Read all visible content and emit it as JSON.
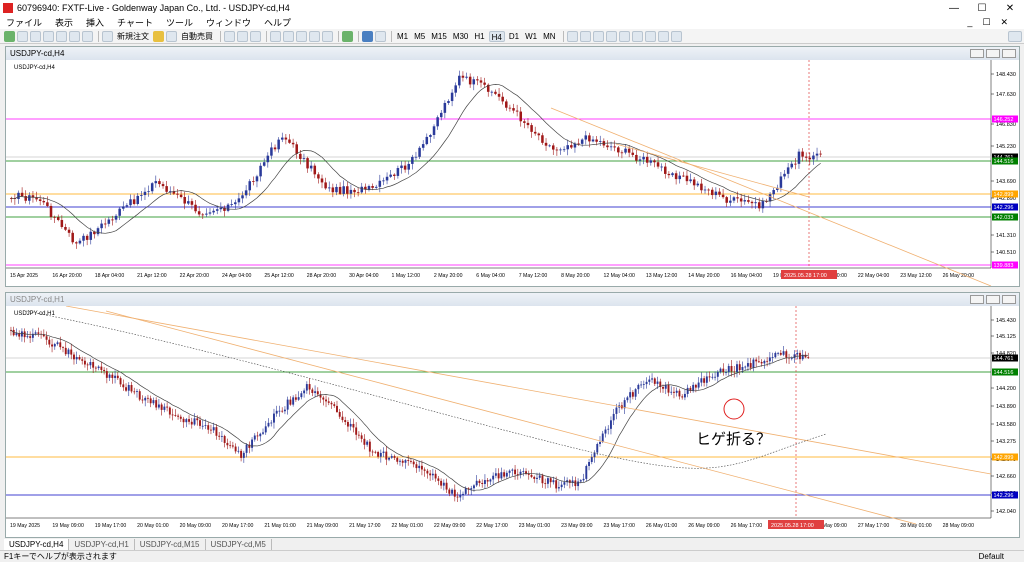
{
  "window": {
    "title": "60796940: FXTF-Live - Goldenway Japan Co., Ltd. - USDJPY-cd,H4",
    "minimize": "—",
    "maximize": "☐",
    "close": "✕"
  },
  "menu": [
    "ファイル",
    "表示",
    "挿入",
    "チャート",
    "ツール",
    "ウィンドウ",
    "ヘルプ"
  ],
  "menu_right": [
    "_",
    "☐",
    "✕"
  ],
  "toolbar": {
    "new_order": "新規注文",
    "auto_trade": "自動売買",
    "timeframes": [
      "M1",
      "M5",
      "M15",
      "M30",
      "H1",
      "H4",
      "D1",
      "W1",
      "MN"
    ],
    "active_timeframe": "H4"
  },
  "charts": [
    {
      "window_title": "USDJPY-cd,H4",
      "label": "USDJPY-cd,H4",
      "price_labels": [
        "148.430",
        "147.630",
        "146.830",
        "145.230",
        "143.690",
        "142.890",
        "141.310",
        "140.510"
      ],
      "marker_labels": [
        {
          "text": "146.252",
          "color": "#ff00ff"
        },
        {
          "text": "144.761",
          "color": "#000000"
        },
        {
          "text": "144.516",
          "color": "#008000"
        },
        {
          "text": "142.899",
          "color": "#ffa500"
        },
        {
          "text": "142.296",
          "color": "#0000c0"
        },
        {
          "text": "142.033",
          "color": "#008000"
        },
        {
          "text": "139.883",
          "color": "#ff00ff"
        }
      ],
      "time_labels": [
        "15 Apr 2025",
        "16 Apr 20:00",
        "18 Apr 04:00",
        "21 Apr 12:00",
        "22 Apr 20:00",
        "24 Apr 04:00",
        "25 Apr 12:00",
        "28 Apr 20:00",
        "30 Apr 04:00",
        "1 May 12:00",
        "2 May 20:00",
        "6 May 04:00",
        "7 May 12:00",
        "8 May 20:00",
        "12 May 04:00",
        "13 May 12:00",
        "14 May 20:00",
        "16 May 04:00",
        "19 May 12:00",
        "20 May 20:00",
        "22 May 04:00",
        "23 May 12:00",
        "26 May 20:00"
      ],
      "cursor_time": "2025.05.28 17:00"
    },
    {
      "window_title": "USDJPY-cd,H1",
      "label": "USDJPY-cd,H1",
      "price_labels": [
        "145.430",
        "145.125",
        "144.820",
        "144.200",
        "143.890",
        "143.580",
        "143.275",
        "142.970",
        "142.660",
        "142.350",
        "142.040"
      ],
      "marker_labels": [
        {
          "text": "144.761",
          "color": "#000000"
        },
        {
          "text": "144.516",
          "color": "#008000"
        },
        {
          "text": "142.899",
          "color": "#ffa500"
        },
        {
          "text": "142.296",
          "color": "#0000c0"
        }
      ],
      "time_labels": [
        "19 May 2025",
        "19 May 09:00",
        "19 May 17:00",
        "20 May 01:00",
        "20 May 09:00",
        "20 May 17:00",
        "21 May 01:00",
        "21 May 09:00",
        "21 May 17:00",
        "22 May 01:00",
        "22 May 09:00",
        "22 May 17:00",
        "23 May 01:00",
        "23 May 09:00",
        "23 May 17:00",
        "26 May 01:00",
        "26 May 09:00",
        "26 May 17:00",
        "27 May 01:00",
        "27 May 09:00",
        "27 May 17:00",
        "28 May 01:00",
        "28 May 09:00"
      ],
      "cursor_time": "2025.05.28 17:00",
      "annotation": "ヒゲ折る？"
    }
  ],
  "tabs": [
    "USDJPY-cd,H4",
    "USDJPY-cd,H1",
    "USDJPY-cd,M15",
    "USDJPY-cd,M5"
  ],
  "active_tab": "USDJPY-cd,H4",
  "status": {
    "help": "F1キーでヘルプが表示されます",
    "profile": "Default"
  }
}
